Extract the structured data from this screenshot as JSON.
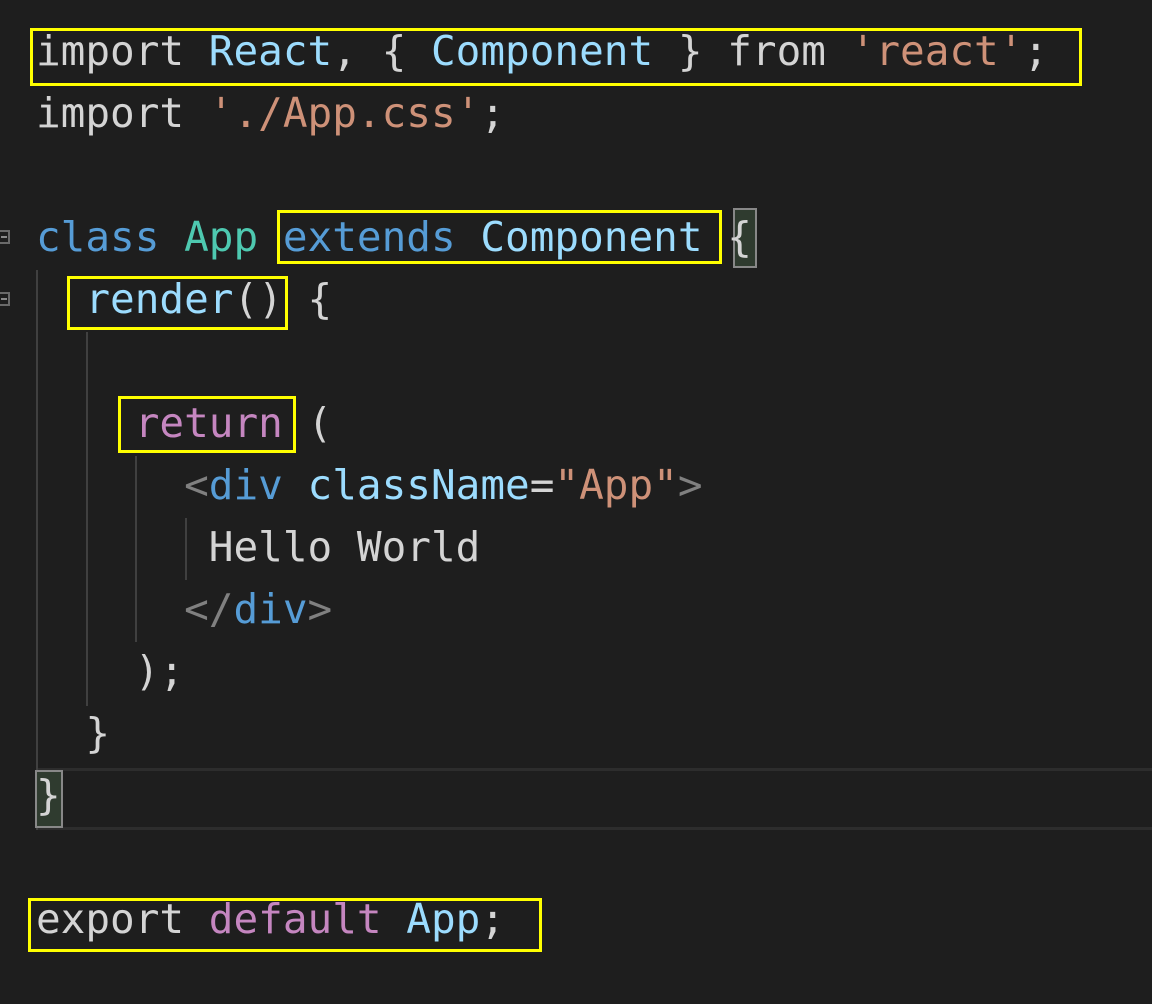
{
  "editor": {
    "lines": [
      {
        "tokens": [
          {
            "text": "import",
            "role": "plain"
          },
          {
            "text": " ",
            "role": "plain"
          },
          {
            "text": "React",
            "role": "ident"
          },
          {
            "text": ", { ",
            "role": "plain"
          },
          {
            "text": "Component",
            "role": "ident"
          },
          {
            "text": " } ",
            "role": "plain"
          },
          {
            "text": "from",
            "role": "plain"
          },
          {
            "text": " ",
            "role": "plain"
          },
          {
            "text": "'react'",
            "role": "string"
          },
          {
            "text": ";",
            "role": "plain"
          }
        ]
      },
      {
        "tokens": [
          {
            "text": "import",
            "role": "plain"
          },
          {
            "text": " ",
            "role": "plain"
          },
          {
            "text": "'./App.css'",
            "role": "string"
          },
          {
            "text": ";",
            "role": "plain"
          }
        ]
      },
      {
        "tokens": []
      },
      {
        "tokens": [
          {
            "text": "class",
            "role": "keyword"
          },
          {
            "text": " ",
            "role": "plain"
          },
          {
            "text": "App",
            "role": "type"
          },
          {
            "text": " ",
            "role": "plain"
          },
          {
            "text": "extends",
            "role": "keyword"
          },
          {
            "text": " ",
            "role": "plain"
          },
          {
            "text": "Component",
            "role": "ident"
          },
          {
            "text": " ",
            "role": "plain"
          },
          {
            "text": "{",
            "role": "plain"
          }
        ]
      },
      {
        "tokens": [
          {
            "text": "  ",
            "role": "plain"
          },
          {
            "text": "render",
            "role": "ident"
          },
          {
            "text": "() {",
            "role": "plain"
          }
        ]
      },
      {
        "tokens": []
      },
      {
        "tokens": [
          {
            "text": "    ",
            "role": "plain"
          },
          {
            "text": "return",
            "role": "control"
          },
          {
            "text": " (",
            "role": "plain"
          }
        ]
      },
      {
        "tokens": [
          {
            "text": "      ",
            "role": "plain"
          },
          {
            "text": "<",
            "role": "punct"
          },
          {
            "text": "div",
            "role": "keyword"
          },
          {
            "text": " ",
            "role": "plain"
          },
          {
            "text": "className",
            "role": "ident"
          },
          {
            "text": "=",
            "role": "plain"
          },
          {
            "text": "\"App\"",
            "role": "string"
          },
          {
            "text": ">",
            "role": "punct"
          }
        ]
      },
      {
        "tokens": [
          {
            "text": "       ",
            "role": "plain"
          },
          {
            "text": "Hello World",
            "role": "plain"
          }
        ]
      },
      {
        "tokens": [
          {
            "text": "      ",
            "role": "plain"
          },
          {
            "text": "</",
            "role": "punct"
          },
          {
            "text": "div",
            "role": "keyword"
          },
          {
            "text": ">",
            "role": "punct"
          }
        ]
      },
      {
        "tokens": [
          {
            "text": "    ",
            "role": "plain"
          },
          {
            "text": ");",
            "role": "plain"
          }
        ]
      },
      {
        "tokens": [
          {
            "text": "  ",
            "role": "plain"
          },
          {
            "text": "}",
            "role": "plain"
          }
        ]
      },
      {
        "tokens": [
          {
            "text": "}",
            "role": "plain"
          }
        ]
      },
      {
        "tokens": []
      },
      {
        "tokens": [
          {
            "text": "export",
            "role": "plain"
          },
          {
            "text": " ",
            "role": "plain"
          },
          {
            "text": "default",
            "role": "control"
          },
          {
            "text": " ",
            "role": "plain"
          },
          {
            "text": "App",
            "role": "ident"
          },
          {
            "text": ";",
            "role": "plain"
          }
        ]
      }
    ]
  },
  "colors": {
    "background": "#1e1e1e",
    "highlight_box": "#ffff00",
    "plain": "#d4d4d4",
    "keyword": "#569cd6",
    "control": "#c586c0",
    "type": "#4ec9b0",
    "ident": "#9cdcfe",
    "string": "#ce9178",
    "punct": "#808080"
  }
}
